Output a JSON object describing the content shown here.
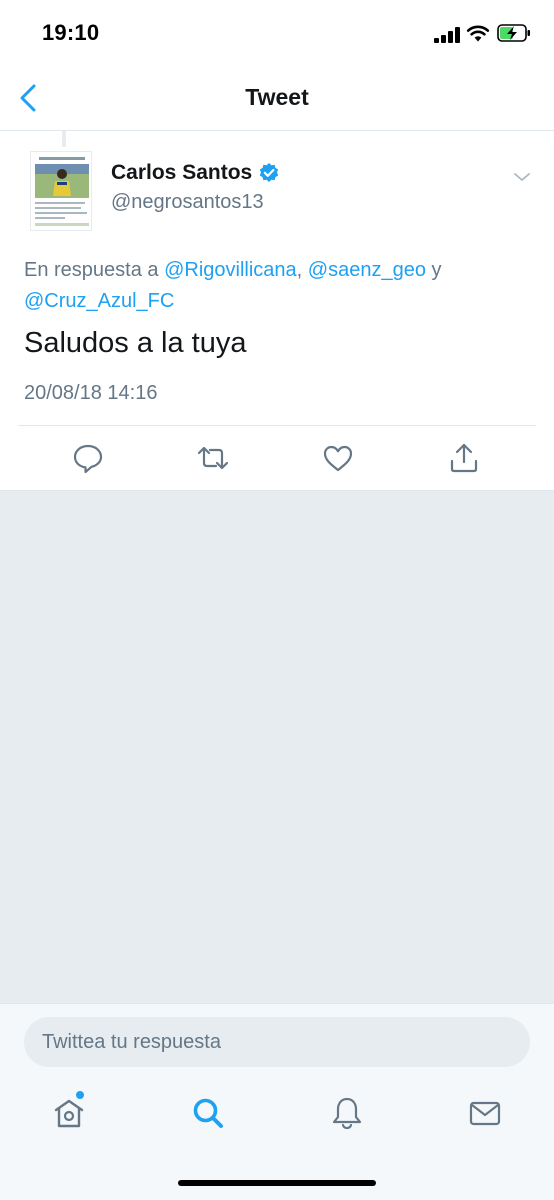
{
  "status_bar": {
    "time": "19:10"
  },
  "nav": {
    "title": "Tweet"
  },
  "tweet": {
    "author_name": "Carlos Santos",
    "author_handle": "@negrosantos13",
    "reply_prefix": "En respuesta a",
    "mentions": [
      "@Rigovillicana",
      "@saenz_geo",
      "@Cruz_Azul_FC"
    ],
    "mention_separator": ",",
    "mention_conjunction": "y",
    "text": "Saludos a la tuya",
    "timestamp": "20/08/18 14:16"
  },
  "composer": {
    "placeholder": "Twittea tu respuesta"
  },
  "colors": {
    "accent": "#1da1f2",
    "secondary_text": "#657786",
    "background_gray": "#e6ecf0",
    "battery_charge": "#4cd964"
  },
  "icons": {
    "back": "chevron-left-icon",
    "verified": "verified-badge-icon",
    "caret": "chevron-down-icon",
    "reply": "reply-icon",
    "retweet": "retweet-icon",
    "like": "heart-icon",
    "share": "share-icon",
    "home": "home-icon",
    "search": "search-icon",
    "notifications": "bell-icon",
    "messages": "mail-icon"
  }
}
